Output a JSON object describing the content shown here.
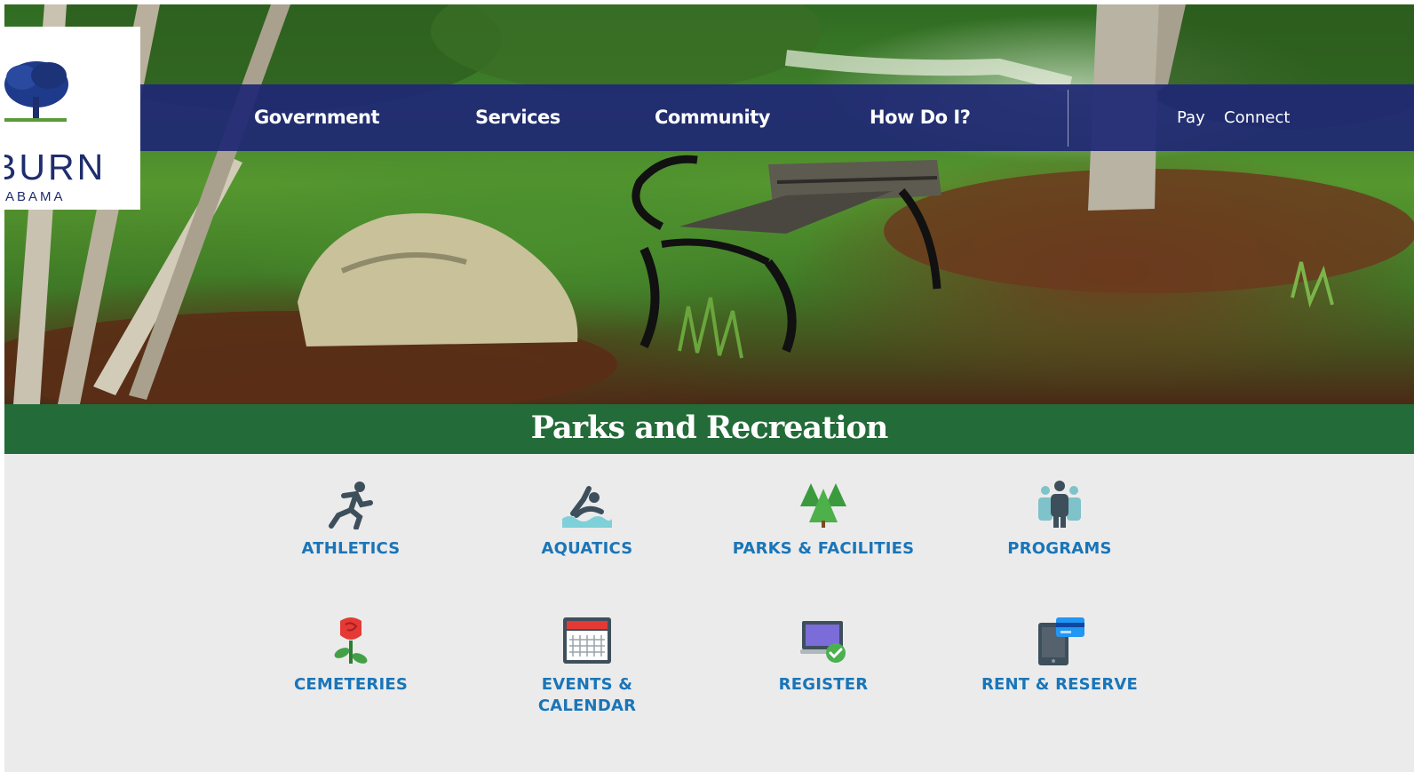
{
  "logo": {
    "text": "BURN",
    "subtext": "ABAMA"
  },
  "nav": {
    "items": [
      "Government",
      "Services",
      "Community",
      "How Do I?"
    ],
    "utility": [
      "Pay",
      "Connect"
    ]
  },
  "page": {
    "title": "Parks and Recreation"
  },
  "tiles": [
    {
      "label_lines": [
        "ATHLETICS"
      ],
      "icon": "runner-icon"
    },
    {
      "label_lines": [
        "AQUATICS"
      ],
      "icon": "swimmer-icon"
    },
    {
      "label_lines": [
        "PARKS & FACILITIES"
      ],
      "icon": "pine-trees-icon"
    },
    {
      "label_lines": [
        "PROGRAMS"
      ],
      "icon": "people-group-icon"
    },
    {
      "label_lines": [
        "CEMETERIES"
      ],
      "icon": "rose-icon"
    },
    {
      "label_lines": [
        "EVENTS &",
        "CALENDAR"
      ],
      "icon": "calendar-icon"
    },
    {
      "label_lines": [
        "REGISTER"
      ],
      "icon": "laptop-check-icon"
    },
    {
      "label_lines": [
        "RENT & RESERVE"
      ],
      "icon": "tablet-card-icon"
    }
  ],
  "colors": {
    "nav_bg": "#1f2874",
    "title_band": "#236b38",
    "tile_label": "#1a75b8",
    "content_bg": "#ebebeb",
    "logo_text": "#1e2d6d"
  }
}
